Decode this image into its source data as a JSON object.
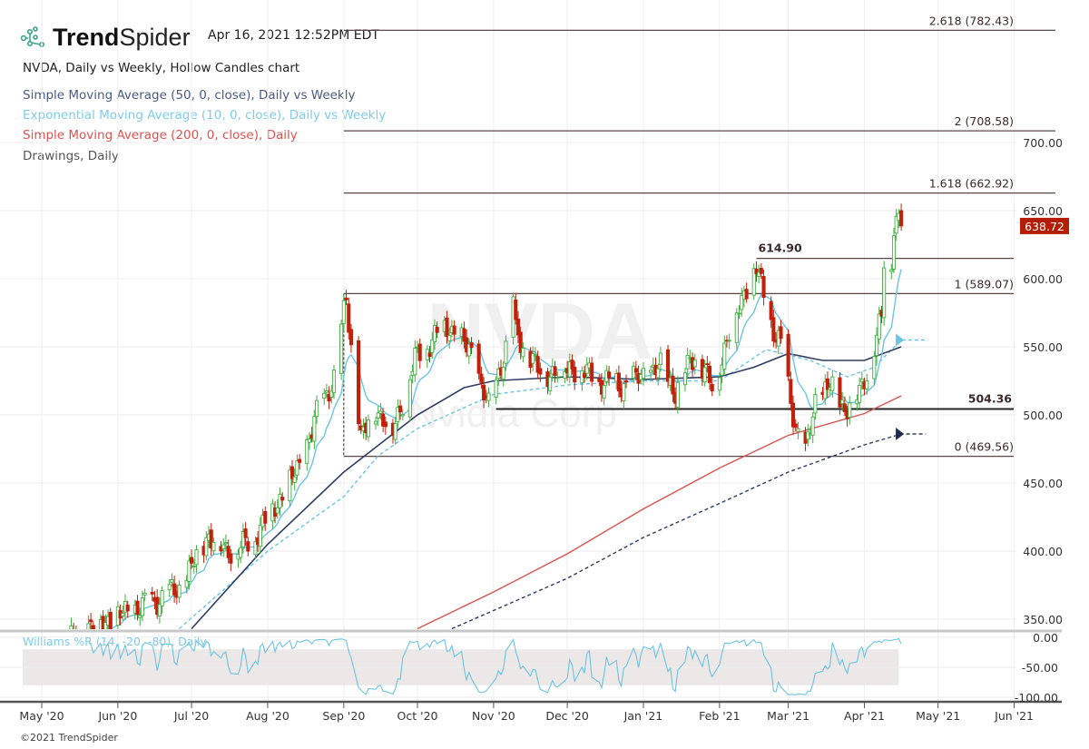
{
  "header": {
    "brand_bold": "Trend",
    "brand_light": "Spider",
    "timestamp": "Apr 16, 2021 12:52PM EDT",
    "chart_title": "NVDA, Daily vs Weekly, Hollow Candles chart",
    "legend": [
      {
        "label": "Simple Moving Average (50, 0, close), Daily vs Weekly",
        "color": "#4a5a85"
      },
      {
        "label": "Exponential Moving Average (10, 0, close), Daily vs Weekly",
        "color": "#7fcbe8"
      },
      {
        "label": "Simple Moving Average (200, 0, close), Daily",
        "color": "#d9534f"
      },
      {
        "label": "Drawings, Daily",
        "color": "#555555"
      }
    ]
  },
  "watermark": {
    "symbol": "NVDA",
    "name": "Nvidia Corp"
  },
  "footer": "©2021 TrendSpider",
  "colors": {
    "up": "#3fae3f",
    "down": "#c1200b",
    "sma50": "#2e3d63",
    "ema10": "#6cc3e2",
    "sma200": "#d9534f",
    "last_badge": "#b51d02"
  },
  "chart_data": {
    "type": "candlestick",
    "symbol": "NVDA",
    "ylim": [
      330,
      790
    ],
    "price_ticks": [
      "350.00",
      "400.00",
      "450.00",
      "500.00",
      "550.00",
      "600.00",
      "650.00",
      "700.00"
    ],
    "price_tick_values": [
      350,
      400,
      450,
      500,
      550,
      600,
      650,
      700
    ],
    "x_ticks": [
      {
        "label": "May '20",
        "date": "2020-05-01"
      },
      {
        "label": "Jun '20",
        "date": "2020-06-01"
      },
      {
        "label": "Jul '20",
        "date": "2020-07-01"
      },
      {
        "label": "Aug '20",
        "date": "2020-08-01"
      },
      {
        "label": "Sep '20",
        "date": "2020-09-01"
      },
      {
        "label": "Oct '20",
        "date": "2020-10-01"
      },
      {
        "label": "Nov '20",
        "date": "2020-11-01"
      },
      {
        "label": "Dec '20",
        "date": "2020-12-01"
      },
      {
        "label": "Jan '21",
        "date": "2021-01-01"
      },
      {
        "label": "Feb '21",
        "date": "2021-02-01"
      },
      {
        "label": "Mar '21",
        "date": "2021-03-01"
      },
      {
        "label": "Apr '21",
        "date": "2021-04-01"
      },
      {
        "label": "May '21",
        "date": "2021-05-01"
      },
      {
        "label": "Jun '21",
        "date": "2021-06-01"
      }
    ],
    "last_price": "638.72",
    "close_keypoints": [
      [
        "2020-05-01",
        300
      ],
      [
        "2020-05-15",
        340
      ],
      [
        "2020-05-29",
        350
      ],
      [
        "2020-06-12",
        360
      ],
      [
        "2020-06-26",
        372
      ],
      [
        "2020-07-08",
        412
      ],
      [
        "2020-07-15",
        400
      ],
      [
        "2020-07-24",
        405
      ],
      [
        "2020-08-03",
        430
      ],
      [
        "2020-08-14",
        462
      ],
      [
        "2020-08-21",
        500
      ],
      [
        "2020-08-28",
        528
      ],
      [
        "2020-09-02",
        585
      ],
      [
        "2020-09-08",
        482
      ],
      [
        "2020-09-14",
        505
      ],
      [
        "2020-09-21",
        488
      ],
      [
        "2020-09-30",
        540
      ],
      [
        "2020-10-09",
        560
      ],
      [
        "2020-10-14",
        565
      ],
      [
        "2020-10-23",
        545
      ],
      [
        "2020-10-30",
        505
      ],
      [
        "2020-11-06",
        550
      ],
      [
        "2020-11-09",
        585
      ],
      [
        "2020-11-10",
        560
      ],
      [
        "2020-11-20",
        530
      ],
      [
        "2020-12-04",
        535
      ],
      [
        "2020-12-14",
        525
      ],
      [
        "2020-12-24",
        522
      ],
      [
        "2021-01-08",
        535
      ],
      [
        "2021-01-14",
        518
      ],
      [
        "2021-01-22",
        545
      ],
      [
        "2021-01-29",
        520
      ],
      [
        "2021-02-05",
        560
      ],
      [
        "2021-02-12",
        595
      ],
      [
        "2021-02-16",
        607
      ],
      [
        "2021-02-23",
        562
      ],
      [
        "2021-02-26",
        550
      ],
      [
        "2021-03-04",
        492
      ],
      [
        "2021-03-08",
        470
      ],
      [
        "2021-03-12",
        510
      ],
      [
        "2021-03-18",
        522
      ],
      [
        "2021-03-24",
        505
      ],
      [
        "2021-03-30",
        515
      ],
      [
        "2021-04-05",
        550
      ],
      [
        "2021-04-08",
        570
      ],
      [
        "2021-04-09",
        612
      ],
      [
        "2021-04-12",
        615
      ],
      [
        "2021-04-13",
        640
      ],
      [
        "2021-04-15",
        645
      ],
      [
        "2021-04-16",
        638.72
      ]
    ],
    "sma50_daily": [
      [
        "2020-07-01",
        343
      ],
      [
        "2020-08-01",
        405
      ],
      [
        "2020-09-01",
        458
      ],
      [
        "2020-10-01",
        500
      ],
      [
        "2020-10-20",
        520
      ],
      [
        "2020-11-01",
        525
      ],
      [
        "2020-12-01",
        528
      ],
      [
        "2021-01-01",
        526
      ],
      [
        "2021-02-01",
        528
      ],
      [
        "2021-02-15",
        535
      ],
      [
        "2021-03-01",
        545
      ],
      [
        "2021-03-15",
        540
      ],
      [
        "2021-04-01",
        540
      ],
      [
        "2021-04-16",
        550
      ]
    ],
    "sma50_weekly": [
      [
        "2020-10-15",
        343
      ],
      [
        "2020-12-01",
        380
      ],
      [
        "2021-01-01",
        410
      ],
      [
        "2021-02-01",
        435
      ],
      [
        "2021-03-01",
        458
      ],
      [
        "2021-04-01",
        478
      ],
      [
        "2021-04-16",
        486
      ],
      [
        "2021-04-26",
        486
      ]
    ],
    "ema10_weekly": [
      [
        "2020-06-26",
        343
      ],
      [
        "2020-08-01",
        400
      ],
      [
        "2020-09-01",
        440
      ],
      [
        "2020-09-15",
        470
      ],
      [
        "2020-10-01",
        490
      ],
      [
        "2020-11-01",
        515
      ],
      [
        "2020-12-01",
        522
      ],
      [
        "2021-01-01",
        525
      ],
      [
        "2021-02-01",
        525
      ],
      [
        "2021-02-20",
        548
      ],
      [
        "2021-03-10",
        540
      ],
      [
        "2021-03-25",
        528
      ],
      [
        "2021-04-05",
        535
      ],
      [
        "2021-04-16",
        555
      ],
      [
        "2021-04-26",
        555
      ]
    ],
    "sma200_daily": [
      [
        "2020-10-01",
        343
      ],
      [
        "2020-11-01",
        370
      ],
      [
        "2020-12-01",
        398
      ],
      [
        "2021-01-01",
        431
      ],
      [
        "2021-02-01",
        461
      ],
      [
        "2021-03-01",
        485
      ],
      [
        "2021-04-01",
        501
      ],
      [
        "2021-04-16",
        514
      ]
    ],
    "fib_levels": [
      {
        "label": "2.618 (782.43)",
        "value": 782.43
      },
      {
        "label": "2 (708.58)",
        "value": 708.58
      },
      {
        "label": "1.618 (662.92)",
        "value": 662.92
      },
      {
        "label": "1 (589.07)",
        "value": 589.07
      },
      {
        "label": "0 (469.56)",
        "value": 469.56
      }
    ],
    "horizontal_lines": [
      {
        "label": "614.90",
        "value": 614.9,
        "start": "2021-02-16"
      },
      {
        "label": "504.36",
        "value": 504.36,
        "start": "2020-11-02"
      }
    ],
    "williams_r": {
      "label": "Williams %R (14, -20, -80), Daily",
      "ticks": [
        "0.00",
        "-50.00",
        "-100.00"
      ],
      "tick_values": [
        0,
        -50,
        -100
      ],
      "band": [
        -20,
        -80
      ]
    }
  }
}
